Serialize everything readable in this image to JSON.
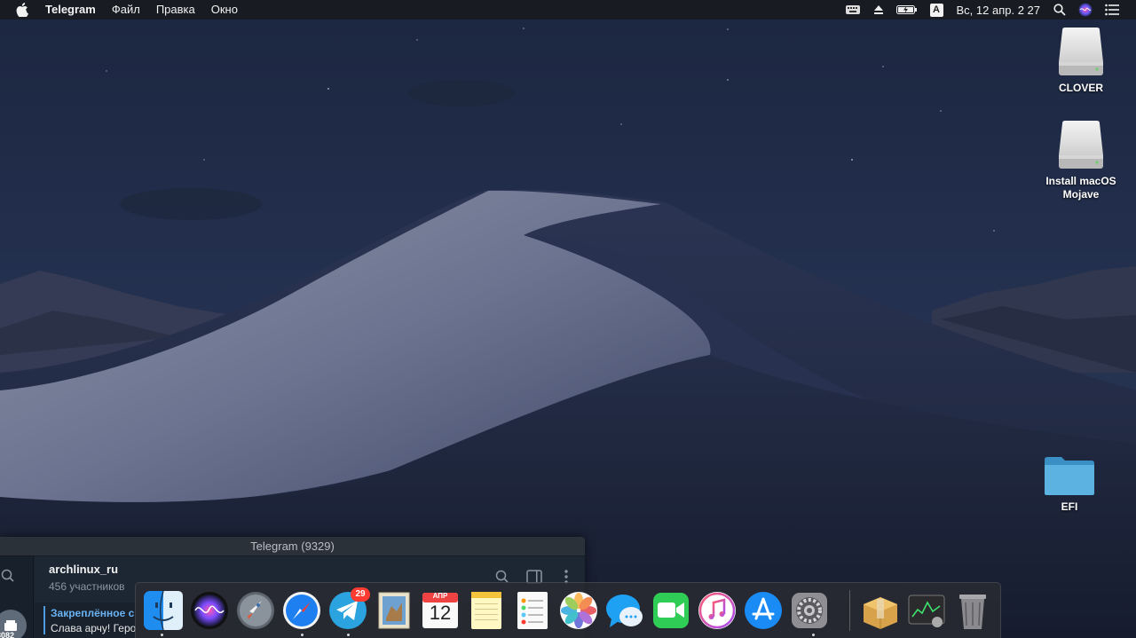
{
  "menubar": {
    "app_name": "Telegram",
    "menus": [
      "Файл",
      "Правка",
      "Окно"
    ],
    "clock": "Вс, 12 апр.  2 27",
    "input_source": "A",
    "status_icons": [
      "keyboard-layout-icon",
      "eject-icon",
      "battery-icon",
      "input-source-icon",
      "spotlight-search-icon",
      "siri-icon",
      "notification-center-icon"
    ]
  },
  "desktop": {
    "icons": [
      {
        "label": "CLOVER",
        "icon": "external-drive-icon"
      },
      {
        "label": "Install macOS Mojave",
        "icon": "external-drive-icon"
      },
      {
        "label": "EFI",
        "icon": "folder-icon"
      }
    ]
  },
  "telegram": {
    "window_title": "Telegram (9329)",
    "chat_name": "archlinux_ru",
    "chat_subtitle": "456 участников",
    "pinned_title": "Закреплённое с",
    "pinned_text": "Слава арчу! Геро",
    "unread_count": "3082"
  },
  "dock": {
    "items": [
      {
        "name": "finder",
        "running": true
      },
      {
        "name": "siri",
        "running": false
      },
      {
        "name": "launchpad",
        "running": false
      },
      {
        "name": "safari",
        "running": true
      },
      {
        "name": "telegram",
        "running": true,
        "badge": "29"
      },
      {
        "name": "mail",
        "running": false
      },
      {
        "name": "calendar",
        "running": false,
        "month": "АПР",
        "day": "12"
      },
      {
        "name": "notes",
        "running": false
      },
      {
        "name": "reminders",
        "running": false
      },
      {
        "name": "photos",
        "running": false
      },
      {
        "name": "messages",
        "running": false
      },
      {
        "name": "facetime",
        "running": false
      },
      {
        "name": "itunes",
        "running": false
      },
      {
        "name": "app-store",
        "running": false
      },
      {
        "name": "system-preferences",
        "running": true
      },
      {
        "name": "archive-utility",
        "running": false
      },
      {
        "name": "activity-monitor",
        "running": false
      },
      {
        "name": "trash",
        "running": false
      }
    ]
  },
  "colors": {
    "telegram_accent": "#4c9ce2",
    "badge_red": "#fe3b30",
    "menubar_bg": "#181a1e"
  }
}
